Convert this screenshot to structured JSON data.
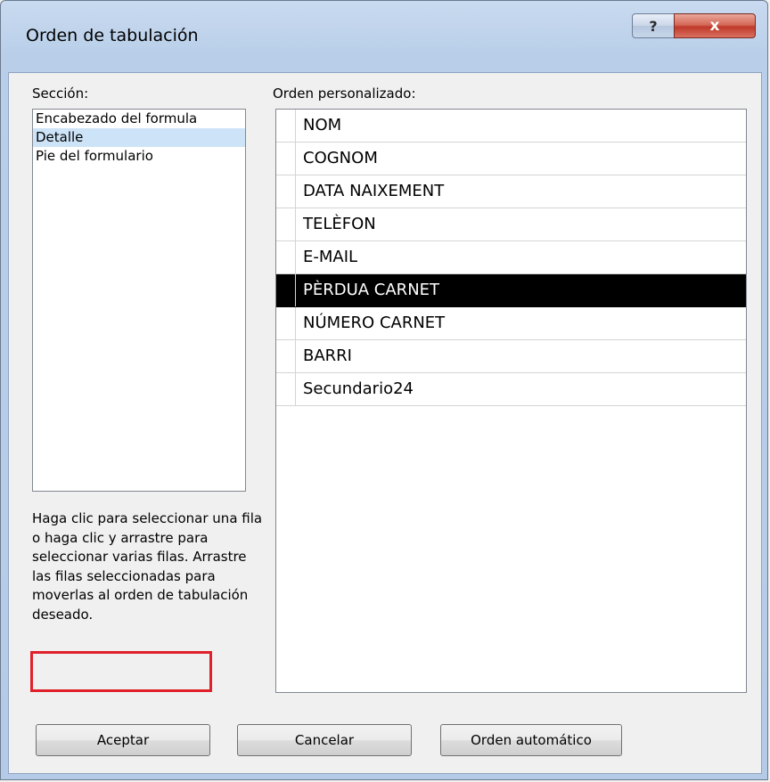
{
  "window": {
    "title": "Orden de tabulación",
    "help_glyph": "?",
    "close_glyph": "x"
  },
  "section_label": "Sección:",
  "sections": [
    {
      "label": "Encabezado del formula",
      "selected": false
    },
    {
      "label": "Detalle",
      "selected": true
    },
    {
      "label": "Pie del formulario",
      "selected": false
    }
  ],
  "custom_order_label": "Orden personalizado:",
  "order_rows": [
    {
      "label": "NOM",
      "selected": false
    },
    {
      "label": "COGNOM",
      "selected": false
    },
    {
      "label": "DATA NAIXEMENT",
      "selected": false
    },
    {
      "label": "TELÈFON",
      "selected": false
    },
    {
      "label": "E-MAIL",
      "selected": false
    },
    {
      "label": "PÈRDUA CARNET",
      "selected": true
    },
    {
      "label": "NÚMERO CARNET",
      "selected": false
    },
    {
      "label": "BARRI",
      "selected": false
    },
    {
      "label": "Secundario24",
      "selected": false
    }
  ],
  "help_text": "Haga clic para seleccionar una fila o haga clic y arrastre para seleccionar varias filas. Arrastre las filas seleccionadas para moverlas al orden de tabulación deseado.",
  "buttons": {
    "accept": "Aceptar",
    "cancel": "Cancelar",
    "auto_order": "Orden automático"
  },
  "colors": {
    "highlight_border": "#e0202a",
    "selected_section_bg": "#cde3f8",
    "selected_row_bg": "#000000"
  }
}
